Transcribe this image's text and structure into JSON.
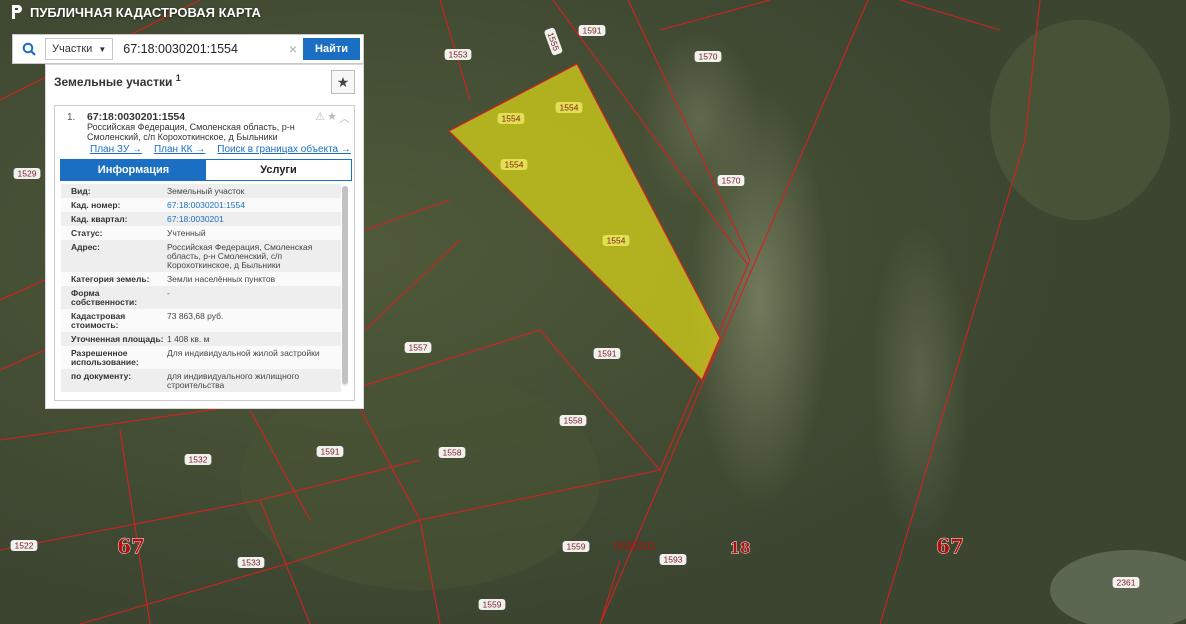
{
  "app": {
    "title": "ПУБЛИЧНАЯ КАДАСТРОВАЯ КАРТА"
  },
  "search": {
    "type_label": "Участки",
    "query": "67:18:0030201:1554",
    "clear_symbol": "×",
    "find_label": "Найти"
  },
  "panel": {
    "title": "Земельные участки",
    "count": "1",
    "card": {
      "index": "1.",
      "cad_number": "67:18:0030201:1554",
      "address": "Российская Федерация, Смоленская область, р-н Смоленский, с/п Корохоткинское, д Быльники",
      "links": [
        "План ЗУ →",
        "План КК →",
        "Поиск в границах объекта →"
      ],
      "tabs": [
        "Информация",
        "Услуги"
      ],
      "rows": [
        {
          "label": "Вид:",
          "value": "Земельный участок"
        },
        {
          "label": "Кад. номер:",
          "value": "67:18:0030201:1554"
        },
        {
          "label": "Кад. квартал:",
          "value": "67:18:0030201"
        },
        {
          "label": "Статус:",
          "value": "Учтенный"
        },
        {
          "label": "Адрес:",
          "value": "Российская Федерация, Смоленская область, р-н Смоленский, с/п Корохоткинское, д Быльники"
        },
        {
          "label": "Категория земель:",
          "value": "Земли населённых пунктов"
        },
        {
          "label": "Форма собственности:",
          "value": "-"
        },
        {
          "label": "Кадастровая стоимость:",
          "value": "73 863,68 руб."
        },
        {
          "label": "Уточненная площадь:",
          "value": "1 408 кв. м"
        },
        {
          "label": "Разрешенное использование:",
          "value": "Для индивидуальной жилой застройки"
        },
        {
          "label": "по документу:",
          "value": "для индивидуального жилищного строительства"
        }
      ]
    }
  },
  "map": {
    "parcel_labels": [
      "1553",
      "1555",
      "1591",
      "1570",
      "1554",
      "1554",
      "1554",
      "1554",
      "1570",
      "1529",
      "1557",
      "1591",
      "1558",
      "1591",
      "1558",
      "1532",
      "1522",
      "1533",
      "1559",
      "0030201",
      "1593",
      "1559",
      "2361"
    ],
    "region_labels": [
      "67",
      "18",
      "67"
    ],
    "colors": {
      "boundary": "#d42020",
      "highlight": "#d6d21a",
      "label_text": "#7a1a1a",
      "region_text": "#b01010"
    }
  }
}
